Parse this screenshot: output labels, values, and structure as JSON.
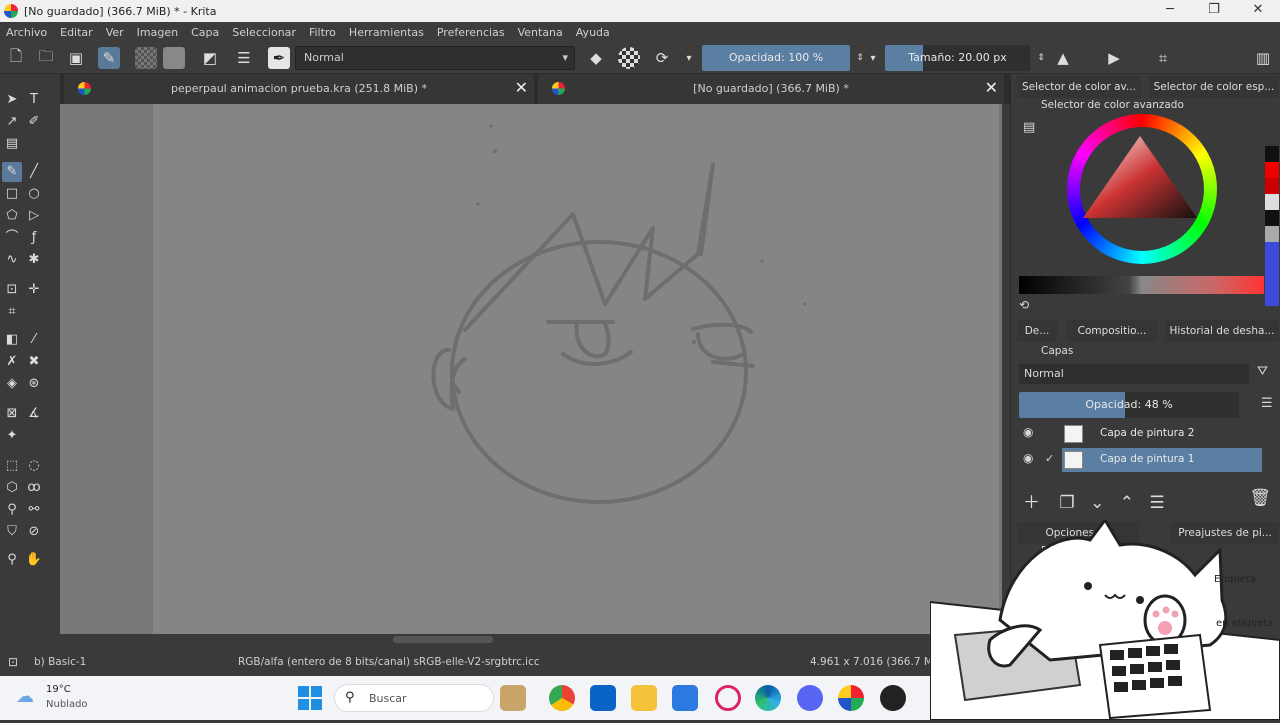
{
  "window": {
    "title": "[No guardado]  (366.7 MiB) * - Krita"
  },
  "menu": [
    "Archivo",
    "Editar",
    "Ver",
    "Imagen",
    "Capa",
    "Seleccionar",
    "Filtro",
    "Herramientas",
    "Preferencias",
    "Ventana",
    "Ayuda"
  ],
  "toolbar": {
    "blend_mode": "Normal",
    "opacity_label": "Opacidad: 100 %",
    "opacity_value": 1.0,
    "size_label": "Tamaño: 20.00 px"
  },
  "tabs": [
    {
      "label": "peperpaul animacion prueba.kra (251.8 MiB) *"
    },
    {
      "label": "[No guardado]  (366.7 MiB) *"
    }
  ],
  "docker": {
    "top_tabs": [
      "Selector de color av...",
      "Selector de color esp..."
    ],
    "color_selector_title": "Selector de color avanzado",
    "mid_tabs": [
      "De...",
      "Compositio...",
      "Historial de desha..."
    ],
    "layers_title": "Capas",
    "layers_blend": "Normal",
    "layers_opacity_label": "Opacidad: 48 %",
    "layers_opacity_value": 0.48,
    "layers": [
      {
        "name": "Capa de pintura 2",
        "selected": false
      },
      {
        "name": "Capa de pintura 1",
        "selected": true
      }
    ],
    "bottom_tabs": [
      "Opciones de herramie...",
      "Preajustes de pi..."
    ],
    "preset_title": "Pre...",
    "tag_label": "Etiqueta",
    "tag_label2": "en etiqueta"
  },
  "status": {
    "brush": "b) Basic-1",
    "color_info": "RGB/alfa (entero de 8 bits/canal)  sRGB-elle-V2-srgbtrc.icc",
    "dims": "4.961 x 7.016 (366.7 MiB)"
  },
  "taskbar": {
    "weather_temp": "19°C",
    "weather_desc": "Nublado",
    "search_placeholder": "Buscar"
  },
  "colors": {
    "accent": "#5b7fa3",
    "canvas": "#858585",
    "panel": "#3a3a3a"
  }
}
